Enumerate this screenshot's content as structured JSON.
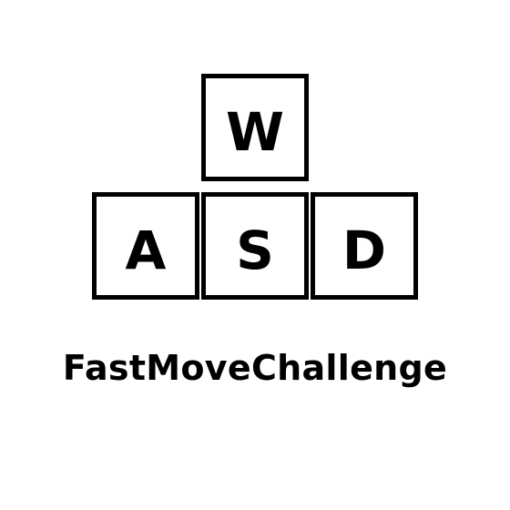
{
  "keys": {
    "w": "W",
    "a": "A",
    "s": "S",
    "d": "D"
  },
  "title": "FastMoveChallenge",
  "colors": {
    "background": "#ffffff",
    "foreground": "#000000"
  }
}
